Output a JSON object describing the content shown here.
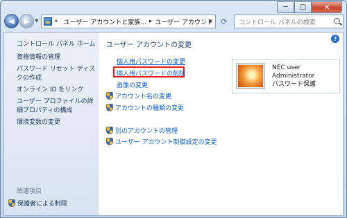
{
  "window": {
    "caption": {
      "minimize": "─",
      "maximize": "□",
      "close": "✕"
    }
  },
  "nav": {
    "back_icon": "back-arrow-icon",
    "forward_icon": "forward-arrow-icon",
    "breadcrumb": [
      "«",
      "ユーザー アカウントと家族...",
      "ユーザー アカウント"
    ],
    "breadcrumb_separator": "▸",
    "refresh_icon": "⟳",
    "search_placeholder": "コントロール パネルの検索"
  },
  "sidebar": {
    "home": "コントロール パネル ホーム",
    "links": [
      "資格情報の管理",
      "パスワード リセット ディスクの作成",
      "オンライン ID をリンク",
      "ユーザー プロファイルの詳細プロパティの構成",
      "環境変数の変更"
    ],
    "related_heading": "関連項目",
    "parental": "保護者による制限"
  },
  "main": {
    "title": "ユーザー アカウントの変更",
    "tasks": [
      "個人用パスワードの変更",
      "個人用パスワードの削除",
      "画像の変更"
    ],
    "shield_tasks": [
      "アカウント名の変更",
      "アカウントの種類の変更",
      "別のアカウントの管理",
      "ユーザー アカウント制御設定の変更"
    ],
    "help": "?"
  },
  "user": {
    "name": "NEC user",
    "role": "Administrator",
    "status": "パスワード保護"
  },
  "colors": {
    "link": "#1560c6",
    "sidebar_text": "#1e395b",
    "highlight": "#e0201b"
  }
}
